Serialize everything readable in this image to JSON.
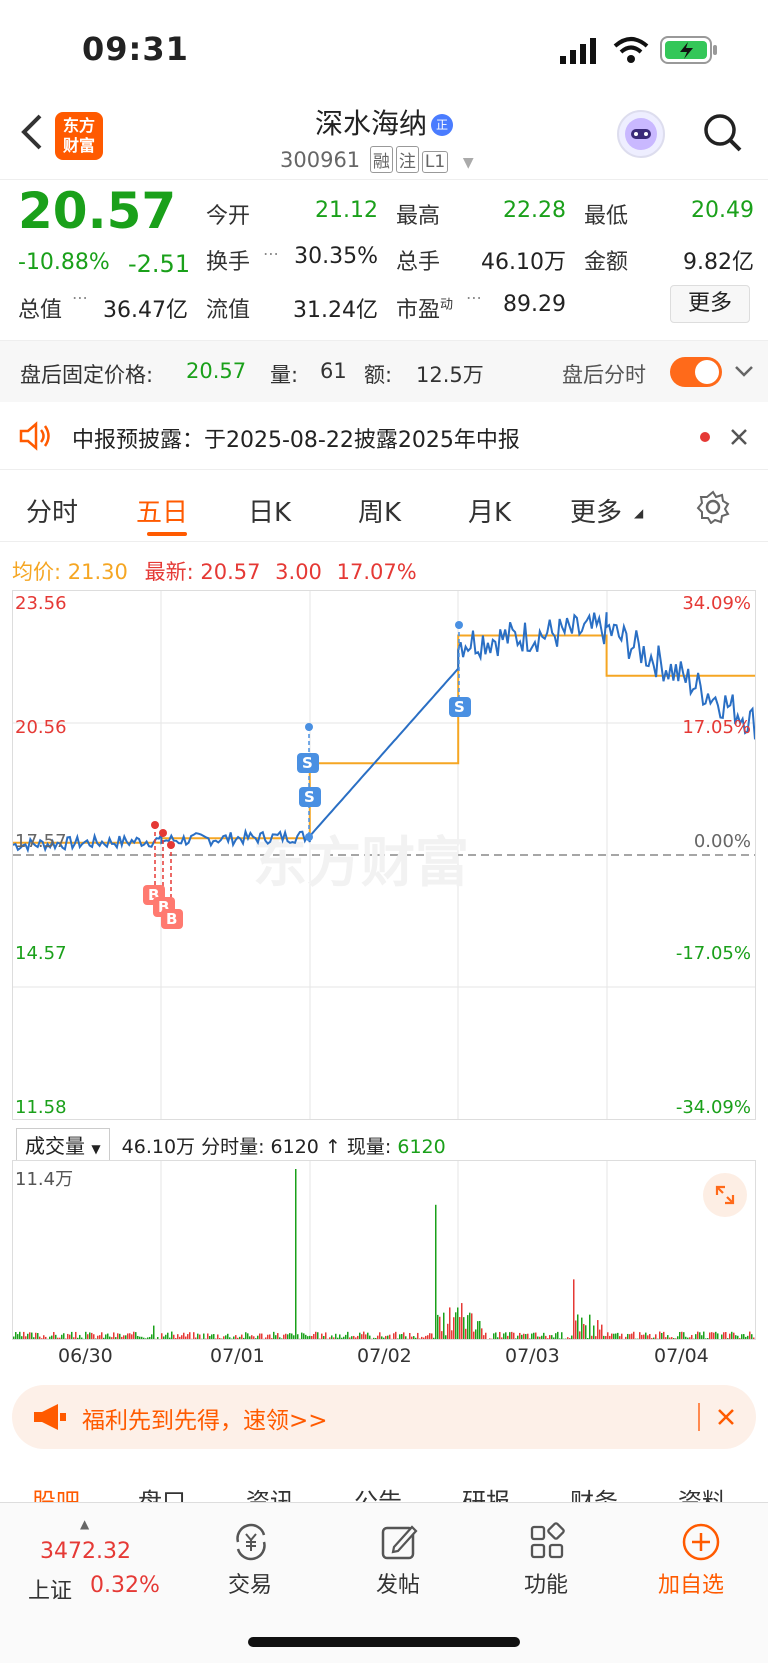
{
  "status": {
    "time": "09:31"
  },
  "header": {
    "logo_text": "东方财富",
    "stock_name": "深水海纳",
    "badge": "正",
    "code": "300961",
    "tags": [
      "融",
      "注",
      "L1"
    ]
  },
  "quote": {
    "price": "20.57",
    "change_pct": "-10.88%",
    "change": "-2.51",
    "fields": [
      {
        "label": "今开",
        "value": "21.12"
      },
      {
        "label": "最高",
        "value": "22.28"
      },
      {
        "label": "最低",
        "value": "20.49"
      },
      {
        "label": "换手",
        "value": "30.35%"
      },
      {
        "label": "总手",
        "value": "46.10万"
      },
      {
        "label": "金额",
        "value": "9.82亿"
      },
      {
        "label": "总值",
        "value": "36.47亿"
      },
      {
        "label": "流值",
        "value": "31.24亿"
      },
      {
        "label": "市盈",
        "label_sup": "动",
        "value": "89.29"
      }
    ],
    "more_label": "更多"
  },
  "after_hours": {
    "price_label": "盘后固定价格:",
    "price": "20.57",
    "vol_label": "量:",
    "vol": "61",
    "amt_label": "额:",
    "amt": "12.5万",
    "toggle_label": "盘后分时"
  },
  "notice": {
    "text": "中报预披露：于2025-08-22披露2025年中报"
  },
  "tabs": [
    "分时",
    "五日",
    "日K",
    "周K",
    "月K",
    "更多"
  ],
  "active_tab": "五日",
  "legend": {
    "avg_label": "均价:",
    "avg": "21.30",
    "latest_label": "最新:",
    "latest": "20.57",
    "chg": "3.00",
    "pct": "17.07%"
  },
  "chart_left_labels": [
    "23.56",
    "20.56",
    "17.57",
    "14.57",
    "11.58"
  ],
  "chart_right_labels": [
    "34.09%",
    "17.05%",
    "0.00%",
    "-17.05%",
    "-34.09%"
  ],
  "watermark": "东方财富",
  "volume": {
    "selector": "成交量",
    "total": "46.10万",
    "tick_label": "分时量:",
    "tick": "6120",
    "now_label": "现量:",
    "now": "6120",
    "max_label": "11.4万"
  },
  "dates": [
    "06/30",
    "07/01",
    "07/02",
    "07/03",
    "07/04"
  ],
  "promo": {
    "text": "福利先到先得，速领>>"
  },
  "subtabs": [
    "股吧",
    "盘口",
    "资讯",
    "公告",
    "研报",
    "财务",
    "资料"
  ],
  "bottom": {
    "index_value": "3472.32",
    "index_name": "上证",
    "index_pct": "0.32%",
    "items": [
      "交易",
      "发帖",
      "功能",
      "加自选"
    ]
  },
  "chart_data": {
    "type": "line",
    "x": [
      "06/30",
      "07/01",
      "07/02",
      "07/03",
      "07/04"
    ],
    "series": [
      {
        "values": [
          17.9,
          18.0,
          21.8,
          22.7,
          20.57
        ]
      }
    ],
    "ylim": [
      11.58,
      23.56
    ],
    "volume_ylim": [
      0,
      11.4
    ]
  }
}
